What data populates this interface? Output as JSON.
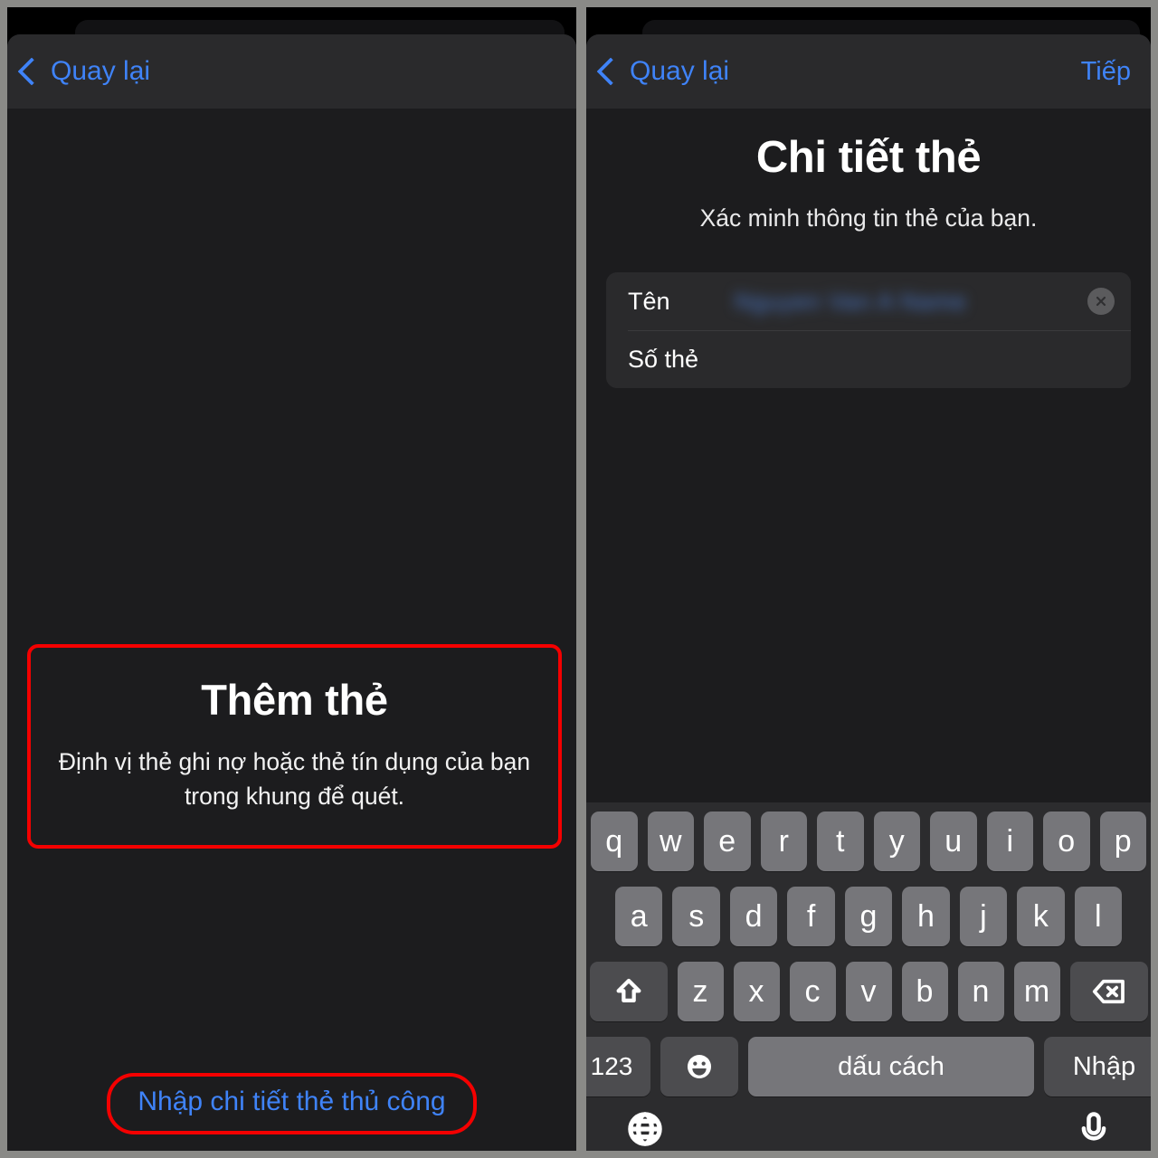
{
  "theme": {
    "accent_blue": "#3f83f8",
    "highlight_red": "#f40000",
    "sheet_bg": "#1c1c1e",
    "navbar_bg": "#2a2a2c",
    "card_bg": "#2a2a2c",
    "key_bg": "#76767a",
    "keyboard_bg": "#2c2c2e"
  },
  "left_panel": {
    "navbar": {
      "back_label": "Quay lại"
    },
    "scan_callout": {
      "title": "Thêm thẻ",
      "description": "Định vị thẻ ghi nợ hoặc thẻ tín dụng của bạn trong khung để quét."
    },
    "manual_entry_label": "Nhập chi tiết thẻ thủ công"
  },
  "right_panel": {
    "navbar": {
      "back_label": "Quay lại",
      "next_label": "Tiếp"
    },
    "page": {
      "title": "Chi tiết thẻ",
      "subtitle": "Xác minh thông tin thẻ của bạn."
    },
    "form": {
      "rows": [
        {
          "label": "Tên",
          "value": "Nguyen Van A Name",
          "redacted": true,
          "has_clear": true
        },
        {
          "label": "Số thẻ",
          "value": "",
          "redacted": false,
          "has_clear": false
        }
      ]
    },
    "keyboard": {
      "row1": [
        "q",
        "w",
        "e",
        "r",
        "t",
        "y",
        "u",
        "i",
        "o",
        "p"
      ],
      "row2": [
        "a",
        "s",
        "d",
        "f",
        "g",
        "h",
        "j",
        "k",
        "l"
      ],
      "row3": [
        "z",
        "x",
        "c",
        "v",
        "b",
        "n",
        "m"
      ],
      "shift_icon": "shift-icon",
      "backspace_icon": "backspace-icon",
      "numbers_label": "123",
      "emoji_icon": "emoji-icon",
      "space_label": "dấu cách",
      "enter_label": "Nhập",
      "globe_icon": "globe-icon",
      "mic_icon": "microphone-icon"
    }
  }
}
